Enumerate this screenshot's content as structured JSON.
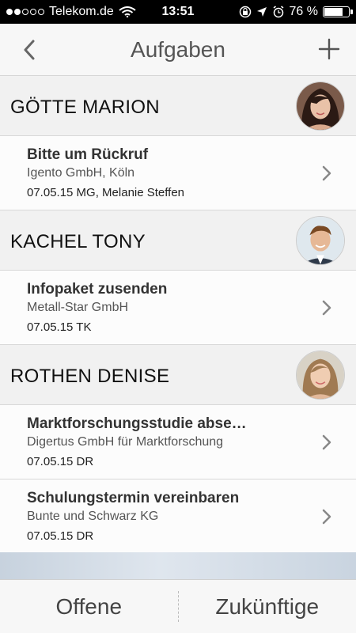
{
  "status_bar": {
    "carrier": "Telekom.de",
    "time": "13:51",
    "battery": "76 %",
    "battery_level": 0.76,
    "signal_bars_filled": 2,
    "signal_bars_total": 5
  },
  "nav": {
    "title": "Aufgaben"
  },
  "groups": [
    {
      "name": "GÖTTE MARION",
      "tasks": [
        {
          "title": "Bitte um Rückruf",
          "company": "Igento GmbH, Köln",
          "meta": "07.05.15 MG, Melanie Steffen"
        }
      ]
    },
    {
      "name": "KACHEL TONY",
      "tasks": [
        {
          "title": "Infopaket zusenden",
          "company": "Metall-Star GmbH",
          "meta": "07.05.15 TK"
        }
      ]
    },
    {
      "name": "ROTHEN DENISE",
      "tasks": [
        {
          "title": "Marktforschungsstudie abse…",
          "company": "Digertus GmbH für Marktforschung",
          "meta": "07.05.15 DR"
        },
        {
          "title": "Schulungstermin vereinbaren",
          "company": "Bunte und Schwarz KG",
          "meta": "07.05.15 DR"
        }
      ]
    }
  ],
  "tabs": {
    "open": "Offene",
    "future": "Zukünftige"
  },
  "colors": {
    "accent": "#555555",
    "background": "#f4f4f4"
  }
}
